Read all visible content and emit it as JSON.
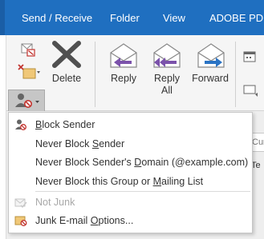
{
  "ribbon_tabs": [
    "Send / Receive",
    "Folder",
    "View",
    "ADOBE PDF"
  ],
  "ribbon_buttons": {
    "delete": "Delete",
    "reply": "Reply",
    "reply_all": "Reply\nAll",
    "reply_all_l1": "Reply",
    "reply_all_l2": "All",
    "forward": "Forward"
  },
  "background_fields": {
    "field1": "Cur",
    "field2": "Te"
  },
  "junk_menu": {
    "items": [
      {
        "label": "Block Sender",
        "accesskey": "B",
        "enabled": true,
        "icon": "block-sender-icon"
      },
      {
        "label": "Never Block Sender",
        "accesskey": "S",
        "enabled": true,
        "icon": ""
      },
      {
        "label": "Never Block Sender's Domain (@example.com)",
        "accesskey": "D",
        "enabled": true,
        "icon": ""
      },
      {
        "label": "Never Block this Group or Mailing List",
        "accesskey": "M",
        "enabled": true,
        "icon": ""
      },
      {
        "label": "Not Junk",
        "accesskey": "",
        "enabled": false,
        "icon": "not-junk-icon"
      },
      {
        "label": "Junk E-mail Options...",
        "accesskey": "O",
        "enabled": true,
        "icon": "junk-options-icon"
      }
    ]
  },
  "colors": {
    "tabbar": "#1f6fc0",
    "menu_bg": "#ffffff",
    "accent_purple": "#7b52ab",
    "accent_blue": "#2a73c4",
    "block_red": "#c2342f"
  }
}
